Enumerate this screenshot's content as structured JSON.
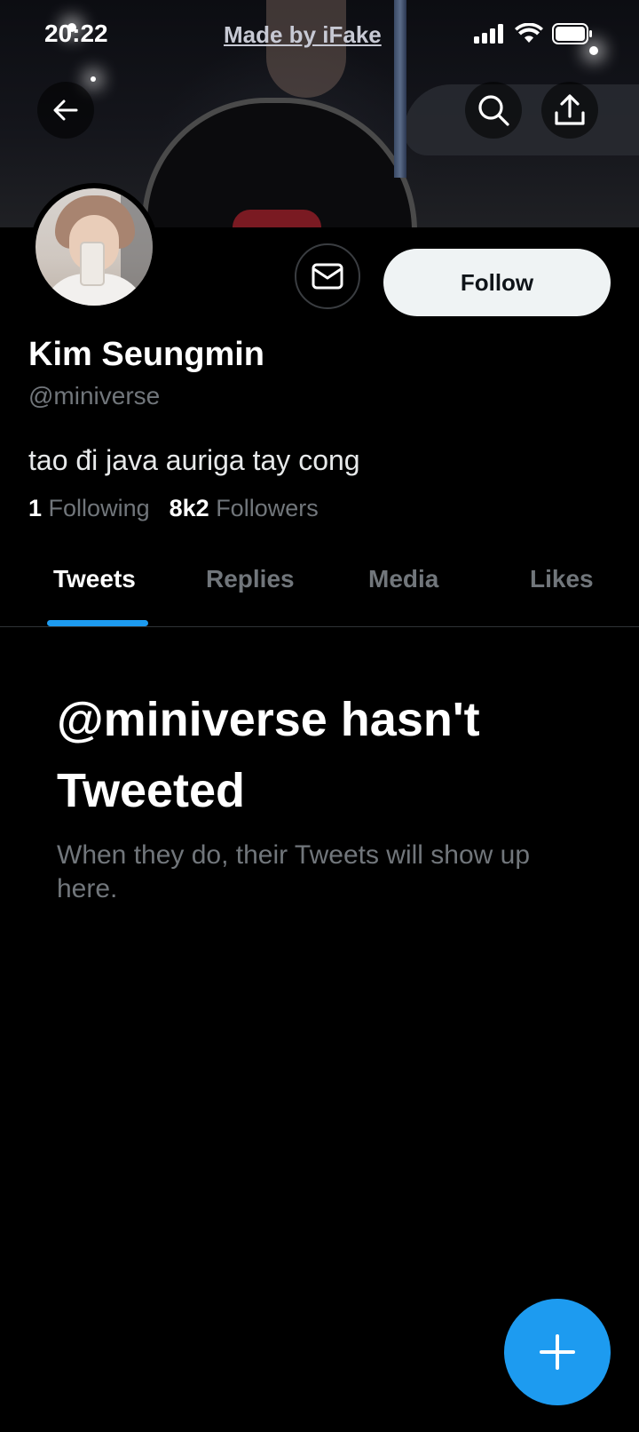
{
  "status_bar": {
    "time": "20:22",
    "watermark": "Made by iFake"
  },
  "profile": {
    "name": "Kim Seungmin",
    "handle": "@miniverse",
    "bio": "tao đi java auriga tay cong",
    "following_count": "1",
    "following_label": "Following",
    "followers_count": "8k2",
    "followers_label": "Followers",
    "follow_label": "Follow"
  },
  "tabs": [
    {
      "label": "Tweets",
      "active": true
    },
    {
      "label": "Replies",
      "active": false
    },
    {
      "label": "Media",
      "active": false
    },
    {
      "label": "Likes",
      "active": false
    }
  ],
  "empty_state": {
    "title": "@miniverse hasn't Tweeted",
    "subtitle": "When they do, their Tweets will show up here."
  },
  "colors": {
    "accent": "#1d9bf0",
    "secondary_text": "#71767b",
    "background": "#000000"
  },
  "icons": [
    "back-arrow-icon",
    "search-icon",
    "share-icon",
    "message-icon",
    "compose-plus-icon"
  ]
}
